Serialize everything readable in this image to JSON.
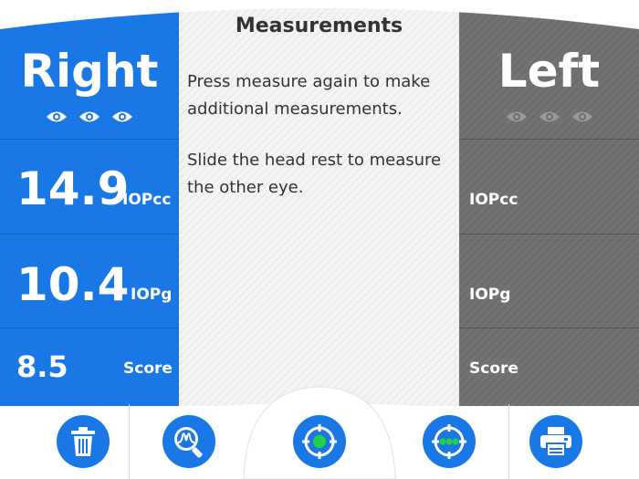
{
  "center": {
    "title": "Measurements",
    "message1": "Press measure again to make additional measurements.",
    "message2": "Slide the head rest to measure the other eye."
  },
  "right_eye": {
    "title": "Right",
    "rows": [
      {
        "value": "14.9",
        "label": "IOPcc"
      },
      {
        "value": "10.4",
        "label": "IOPg"
      },
      {
        "value": "8.5",
        "label": "Score"
      }
    ]
  },
  "left_eye": {
    "title": "Left",
    "rows": [
      {
        "value": "",
        "label": "IOPcc"
      },
      {
        "value": "",
        "label": "IOPg"
      },
      {
        "value": "",
        "label": "Score"
      }
    ]
  },
  "toolbar": {
    "icons": [
      "trash-icon",
      "waveform-search-icon",
      "measure-target-icon",
      "multi-measure-icon",
      "printer-icon"
    ]
  },
  "colors": {
    "accent": "#1a78e6",
    "inactive": "#6e6e6e",
    "center_bg": "#f4f4f2",
    "measure_dot": "#22d14a"
  }
}
